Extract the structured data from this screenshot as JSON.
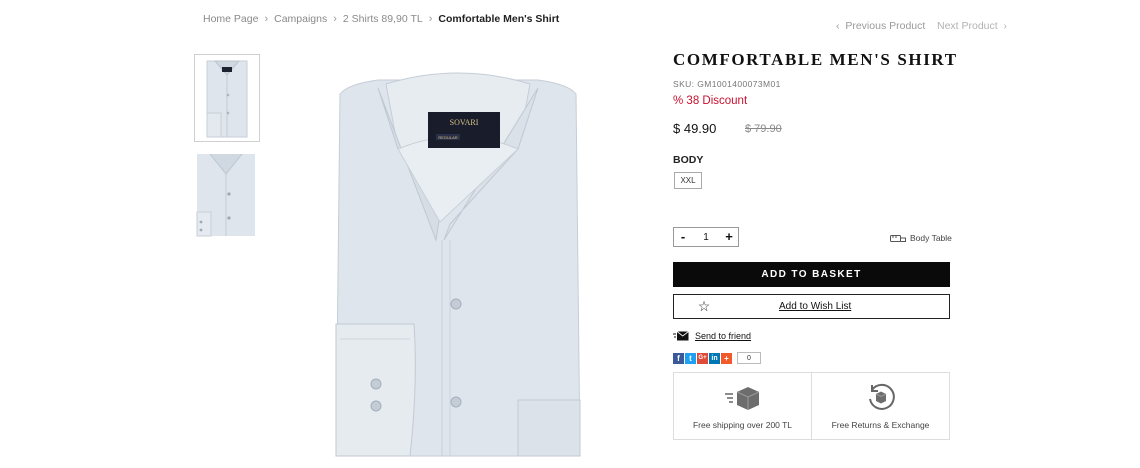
{
  "breadcrumb": {
    "items": [
      "Home Page",
      "Campaigns",
      "2 Shirts 89,90 TL"
    ],
    "current": "Comfortable Men's Shirt",
    "separator": "›"
  },
  "pager": {
    "prev_label": "Previous Product",
    "next_label": "Next Product"
  },
  "shirt_label": {
    "brand": "SOVARI",
    "line": "REGULAR"
  },
  "product": {
    "title": "COMFORTABLE MEN'S SHIRT",
    "sku": "SKU: GM1001400073M01",
    "discount": "% 38 Discount",
    "price": "$ 49.90",
    "old_price": "$ 79.90"
  },
  "options": {
    "body_label": "BODY",
    "sizes": [
      "XXL"
    ]
  },
  "quantity": {
    "minus": "-",
    "value": "1",
    "plus": "+"
  },
  "body_table_label": "Body Table",
  "actions": {
    "add_to_basket": "ADD TO BASKET",
    "add_to_wishlist": "Add to Wish List",
    "send_to_friend": "Send to friend"
  },
  "share": {
    "buttons": [
      "f",
      "t",
      "G+",
      "in",
      "+"
    ],
    "count": "0"
  },
  "features": [
    {
      "icon": "shipping-box-icon",
      "label": "Free shipping over 200 TL"
    },
    {
      "icon": "returns-box-icon",
      "label": "Free Returns & Exchange"
    }
  ],
  "colors": {
    "discount": "#c8102e",
    "basket_bg": "#0a0a0a",
    "shirt": "#dde3ea",
    "facebook": "#3b5998",
    "twitter": "#1da1f2",
    "googleplus": "#dd4b39",
    "linkedin": "#0077b5",
    "addthis": "#f35a2b"
  }
}
